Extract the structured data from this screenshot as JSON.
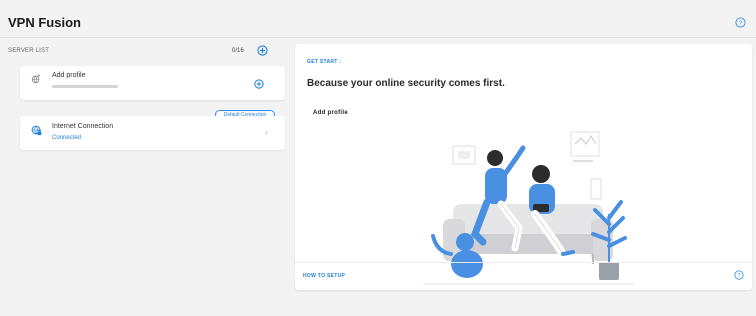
{
  "header": {
    "title": "VPN Fusion",
    "help_icon": "help-circle-icon"
  },
  "server_list": {
    "label": "SERVER LIST",
    "count": "0/16",
    "add_icon": "plus-circle-icon",
    "add_profile": {
      "name": "Add profile",
      "icon": "globe-plus-icon",
      "action_icon": "plus-circle-icon"
    },
    "connection": {
      "name": "Internet Connection",
      "status": "Connected",
      "badge": "Default Connection",
      "icon": "globe-lock-icon",
      "chevron": "›"
    }
  },
  "main_panel": {
    "get_start": "GET START :",
    "heading": "Because your online security comes first.",
    "add_profile": "Add profile",
    "illustration": "people-on-couch-illustration",
    "how_to_setup": "HOW TO SETUP",
    "help_icon": "help-circle-icon"
  },
  "colors": {
    "accent": "#1e7fd8",
    "background": "#f3f3f4",
    "illustration_blue": "#4a90e2"
  }
}
